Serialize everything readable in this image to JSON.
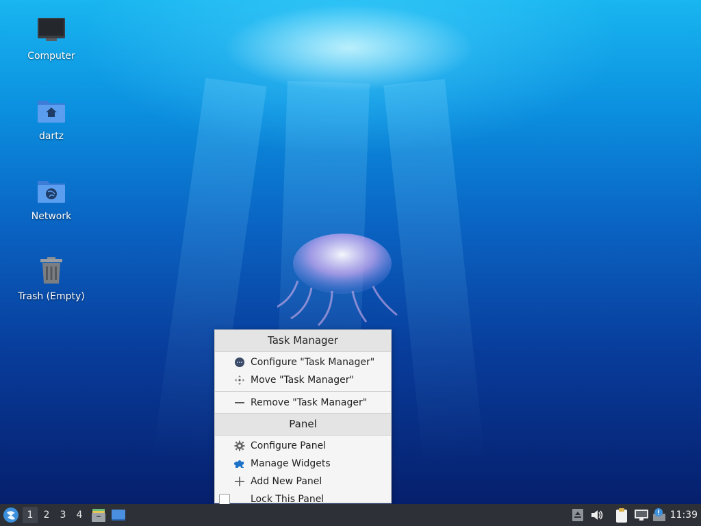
{
  "desktop": {
    "icons": [
      {
        "label": "Computer"
      },
      {
        "label": "dartz"
      },
      {
        "label": "Network"
      },
      {
        "label": "Trash (Empty)"
      }
    ]
  },
  "context_menu": {
    "section1_title": "Task Manager",
    "configure_label": "Configure \"Task Manager\"",
    "move_label": "Move \"Task Manager\"",
    "remove_label": "Remove \"Task Manager\"",
    "section2_title": "Panel",
    "configure_panel_label": "Configure Panel",
    "manage_widgets_label": "Manage Widgets",
    "add_panel_label": "Add New Panel",
    "lock_panel_label": "Lock This Panel"
  },
  "taskbar": {
    "workspaces": [
      "1",
      "2",
      "3",
      "4"
    ],
    "active_workspace": "1",
    "clock": "11:39"
  },
  "icons": {
    "start": "lxqt-start-icon",
    "file_manager": "file-manager-icon",
    "show_desktop": "show-desktop-icon",
    "tray": [
      "updates-icon",
      "volume-icon",
      "clipboard-icon",
      "network-icon",
      "notification-icon"
    ]
  }
}
